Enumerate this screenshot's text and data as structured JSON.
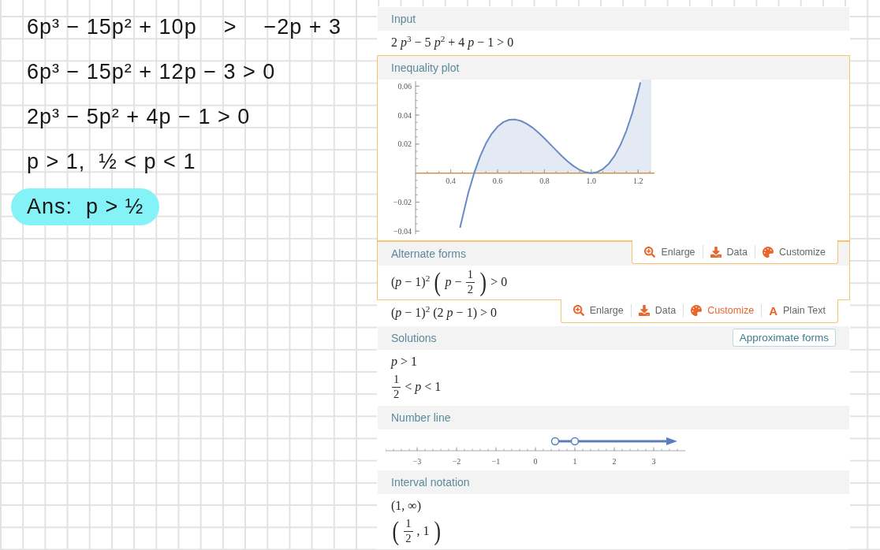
{
  "notes": [
    {
      "text": "6p³ − 15p² + 10p    >    −2p + 3",
      "highlighted": false
    },
    {
      "text": "6p³ − 15p² + 12p − 3 > 0",
      "highlighted": false
    },
    {
      "text": "2p³ − 5p² + 4p − 1 > 0",
      "highlighted": false
    },
    {
      "text": "p > 1,  ½ < p < 1",
      "highlighted": false
    },
    {
      "text": "Ans:  p > ½",
      "highlighted": true
    }
  ],
  "pods": [
    {
      "title": "Input",
      "subpods": [
        {
          "highlighted": false,
          "lines": [
            [
              {
                "kind": "text",
                "text": "2 *p*$^{3}$ − 5 *p*$^{2}$ + 4 *p* − 1 > 0"
              }
            ]
          ]
        }
      ]
    },
    {
      "title": "Inequality plot",
      "subpods": [
        {
          "highlighted": true,
          "chart_data": {
            "type": "line",
            "x": [
              0.44,
              0.475,
              0.5,
              0.525,
              0.55,
              0.575,
              0.6,
              0.625,
              0.65,
              0.675,
              0.7,
              0.725,
              0.75,
              0.775,
              0.8,
              0.825,
              0.85,
              0.875,
              0.9,
              0.925,
              0.95,
              0.975,
              1.0,
              1.025,
              1.05,
              1.075,
              1.1,
              1.125,
              1.15,
              1.175,
              1.2,
              1.21
            ],
            "series": [
              {
                "color": "#6a8bc3",
                "values": [
                  -0.0376,
                  -0.0138,
                  0,
                  0.0113,
                  0.0203,
                  0.0271,
                  0.032,
                  0.0352,
                  0.0368,
                  0.037,
                  0.036,
                  0.034,
                  0.0313,
                  0.0278,
                  0.024,
                  0.0199,
                  0.0158,
                  0.0117,
                  0.008,
                  0.0048,
                  0.0023,
                  0.0006,
                  0,
                  0.0007,
                  0.0028,
                  0.0065,
                  0.012,
                  0.0195,
                  0.0293,
                  0.0413,
                  0.056,
                  0.0626
                ]
              }
            ],
            "xlim": [
              0.25,
              1.27
            ],
            "ylim": [
              -0.042,
              0.0645
            ],
            "xticks": [
              {
                "value": 0.4,
                "label": "0.4"
              },
              {
                "value": 0.6,
                "label": "0.6"
              },
              {
                "value": 0.8,
                "label": "0.8"
              },
              {
                "value": 1.0,
                "label": "1.0"
              },
              {
                "value": 1.2,
                "label": "1.2"
              }
            ],
            "yticks": [
              {
                "value": 0.06,
                "label": "0.06"
              },
              {
                "value": 0.04,
                "label": "0.04"
              },
              {
                "value": 0.02,
                "label": "0.02"
              },
              {
                "value": -0.02,
                "label": "−0.02"
              },
              {
                "value": -0.04,
                "label": "−0.04"
              }
            ]
          },
          "buttons": [
            {
              "kind": "enlarge",
              "label": "Enlarge",
              "hovered": false
            },
            {
              "kind": "data",
              "label": "Data",
              "hovered": false
            },
            {
              "kind": "customize",
              "label": "Customize",
              "hovered": false
            }
          ]
        }
      ]
    },
    {
      "title": "Alternate forms",
      "subpods": [
        {
          "highlighted": true,
          "lines": [
            [
              {
                "kind": "text",
                "text": "(*p* − 1)$^{2}$"
              },
              {
                "kind": "big",
                "text": "("
              },
              {
                "kind": "text",
                "text": "*p* −"
              },
              {
                "kind": "frac",
                "num": "1",
                "den": "2"
              },
              {
                "kind": "big",
                "text": ")"
              },
              {
                "kind": "text",
                "text": "> 0"
              }
            ]
          ],
          "buttons": [
            {
              "kind": "enlarge",
              "label": "Enlarge",
              "hovered": false
            },
            {
              "kind": "data",
              "label": "Data",
              "hovered": false
            },
            {
              "kind": "customize",
              "label": "Customize",
              "hovered": true
            },
            {
              "kind": "plain_text",
              "label": "Plain Text",
              "glyph": "A",
              "hovered": false
            }
          ]
        },
        {
          "highlighted": false,
          "lines": [
            [
              {
                "kind": "text",
                "text": "(*p* − 1)$^{2}$ (2 *p* − 1) > 0"
              }
            ]
          ]
        }
      ]
    },
    {
      "title": "Solutions",
      "header_button": "Approximate forms",
      "subpods": [
        {
          "highlighted": false,
          "lines": [
            [
              {
                "kind": "text",
                "text": "*p* > 1"
              }
            ],
            [
              {
                "kind": "frac",
                "num": "1",
                "den": "2"
              },
              {
                "kind": "text",
                "text": "< *p* < 1"
              }
            ]
          ]
        }
      ]
    },
    {
      "title": "Number line",
      "subpods": [
        {
          "highlighted": false,
          "number_line": {
            "tick_labels": [
              "−3",
              "−2",
              "−1",
              "0",
              "1",
              "2",
              "3"
            ]
          }
        }
      ]
    },
    {
      "title": "Interval notation",
      "subpods": [
        {
          "highlighted": false,
          "lines": [
            [
              {
                "kind": "text",
                "text": "(1, ∞)"
              }
            ],
            [
              {
                "kind": "big",
                "text": "("
              },
              {
                "kind": "frac",
                "num": "1",
                "den": "2"
              },
              {
                "kind": "text",
                "text": ", 1"
              },
              {
                "kind": "big",
                "text": ")"
              }
            ]
          ]
        }
      ]
    }
  ]
}
